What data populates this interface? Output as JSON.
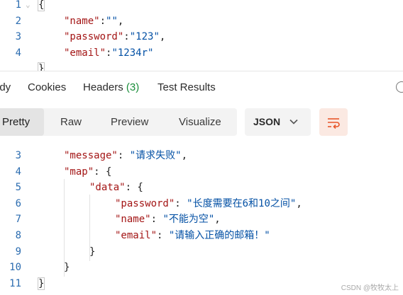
{
  "request_body": [
    {
      "num": "1",
      "fold": true,
      "parts": [
        {
          "t": "p",
          "v": "{"
        }
      ]
    },
    {
      "num": "2",
      "parts": [
        {
          "t": "k",
          "v": "\"name\""
        },
        {
          "t": "p",
          "v": ":"
        },
        {
          "t": "s",
          "v": "\"\""
        },
        {
          "t": "p",
          "v": ","
        }
      ]
    },
    {
      "num": "3",
      "parts": [
        {
          "t": "k",
          "v": "\"password\""
        },
        {
          "t": "p",
          "v": ":"
        },
        {
          "t": "s",
          "v": "\"123\""
        },
        {
          "t": "p",
          "v": ","
        }
      ]
    },
    {
      "num": "4",
      "parts": [
        {
          "t": "k",
          "v": "\"email\""
        },
        {
          "t": "p",
          "v": ":"
        },
        {
          "t": "s",
          "v": "\"1234r\""
        }
      ]
    },
    {
      "num": "",
      "parts": [
        {
          "t": "p",
          "v": "}"
        }
      ]
    }
  ],
  "response_tabs": {
    "body": "ody",
    "cookies": "Cookies",
    "headers": "Headers",
    "headers_count": "(3)",
    "test_results": "Test Results"
  },
  "format_toolbar": {
    "views": [
      "Pretty",
      "Raw",
      "Preview",
      "Visualize"
    ],
    "active_view": "Pretty",
    "language": "JSON"
  },
  "response_body": [
    {
      "num": "3",
      "parts": [
        {
          "t": "k",
          "v": "\"message\""
        },
        {
          "t": "p",
          "v": ": "
        },
        {
          "t": "s",
          "v": "\"请求失败\""
        },
        {
          "t": "p",
          "v": ","
        }
      ]
    },
    {
      "num": "4",
      "parts": [
        {
          "t": "k",
          "v": "\"map\""
        },
        {
          "t": "p",
          "v": ": {"
        }
      ]
    },
    {
      "num": "5",
      "parts": [
        {
          "t": "k",
          "v": "\"data\""
        },
        {
          "t": "p",
          "v": ": {"
        }
      ]
    },
    {
      "num": "6",
      "parts": [
        {
          "t": "k",
          "v": "\"password\""
        },
        {
          "t": "p",
          "v": ": "
        },
        {
          "t": "s",
          "v": "\"长度需要在6和10之间\""
        },
        {
          "t": "p",
          "v": ","
        }
      ]
    },
    {
      "num": "7",
      "parts": [
        {
          "t": "k",
          "v": "\"name\""
        },
        {
          "t": "p",
          "v": ": "
        },
        {
          "t": "s",
          "v": "\"不能为空\""
        },
        {
          "t": "p",
          "v": ","
        }
      ]
    },
    {
      "num": "8",
      "parts": [
        {
          "t": "k",
          "v": "\"email\""
        },
        {
          "t": "p",
          "v": ": "
        },
        {
          "t": "s",
          "v": "\"请输入正确的邮箱！\""
        }
      ]
    },
    {
      "num": "9",
      "parts": [
        {
          "t": "p",
          "v": "}"
        }
      ]
    },
    {
      "num": "10",
      "parts": [
        {
          "t": "p",
          "v": "}"
        }
      ]
    },
    {
      "num": "11",
      "parts": [
        {
          "t": "p",
          "v": "}"
        }
      ]
    }
  ],
  "watermark": "CSDN @牧牧太上",
  "colors": {
    "line_number": "#2b6cb0",
    "json_key": "#a31515",
    "json_string": "#0451a5",
    "tab_count": "#1a8e3a",
    "accent": "#ff6c37"
  }
}
